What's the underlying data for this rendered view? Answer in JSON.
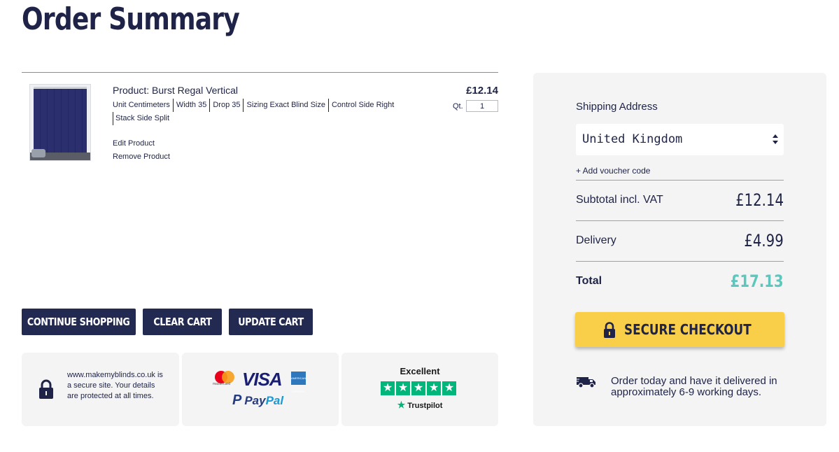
{
  "page": {
    "title": "Order Summary"
  },
  "cart": {
    "item": {
      "product_prefix": "Product:",
      "product_name": "Burst Regal Vertical",
      "attributes": [
        "Unit Centimeters",
        "Width 35",
        "Drop 35",
        "Sizing Exact Blind Size",
        "Control Side Right",
        "Stack Side Split"
      ],
      "edit_label": "Edit Product",
      "remove_label": "Remove Product",
      "price": "£12.14",
      "qty_label": "Qt.",
      "qty_value": "1"
    },
    "buttons": {
      "continue": "CONTINUE SHOPPING",
      "clear": "CLEAR CART",
      "update": "UPDATE CART"
    }
  },
  "trust": {
    "secure_text": "www.makemyblinds.co.uk is a secure site. Your details are protected at all times.",
    "mastercard_label": "mastercard",
    "visa": "VISA",
    "amex": "AMERICAN EXPRESS",
    "paypal_pay": "Pay",
    "paypal_pal": "Pal",
    "trustpilot_rating": "Excellent",
    "trustpilot_brand": "Trustpilot"
  },
  "summary": {
    "shipping_label": "Shipping Address",
    "country": "United Kingdom",
    "voucher_label": "+ Add voucher code",
    "subtotal_label": "Subtotal incl. VAT",
    "subtotal_value": "£12.14",
    "delivery_label": "Delivery",
    "delivery_value": "£4.99",
    "total_label": "Total",
    "total_value": "£17.13",
    "checkout_label": "SECURE CHECKOUT",
    "delivery_note": "Order today and have it delivered in approximately 6-9 working days."
  },
  "colors": {
    "navy": "#1e2347",
    "button_dark": "#232a52",
    "checkout_yellow": "#f9cf4a",
    "total_teal": "#5ec7bd",
    "trustpilot_green": "#00b67a",
    "panel_bg": "#f4f4f5"
  },
  "icons": [
    "product-thumbnail",
    "lock-icon",
    "mastercard-logo",
    "visa-logo",
    "amex-logo",
    "paypal-logo",
    "trustpilot-star-icon",
    "select-arrows-icon",
    "truck-icon"
  ]
}
